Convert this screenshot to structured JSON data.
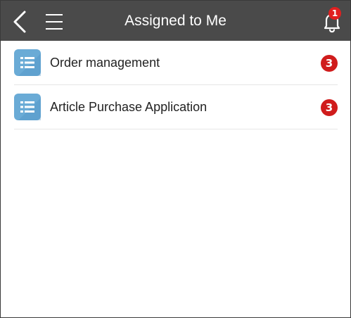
{
  "header": {
    "title": "Assigned to Me",
    "back_icon": "chevron-left-icon",
    "menu_icon": "hamburger-menu-icon",
    "bell_icon": "bell-icon",
    "notification_count": "1"
  },
  "list": {
    "items": [
      {
        "label": "Order management",
        "icon": "app-list-icon",
        "badge": "3"
      },
      {
        "label": "Article Purchase Application",
        "icon": "app-list-icon",
        "badge": "3"
      }
    ]
  },
  "colors": {
    "header_bg": "#4a4a4a",
    "icon_bg": "#6aabd6",
    "badge_red": "#d01c1c"
  }
}
